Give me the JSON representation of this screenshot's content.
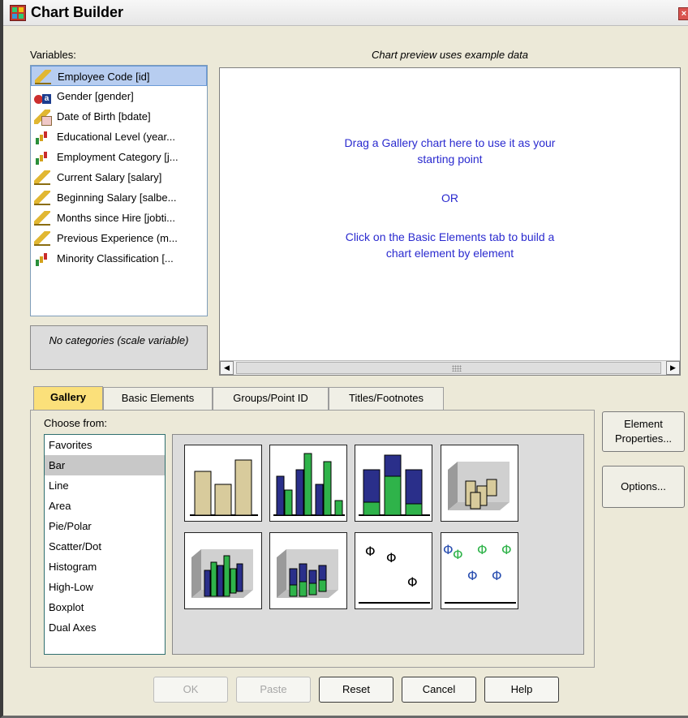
{
  "window": {
    "title": "Chart Builder"
  },
  "variables": {
    "label": "Variables:",
    "items": [
      {
        "label": "Employee Code [id]",
        "icon": "scale-ruler-icon"
      },
      {
        "label": "Gender [gender]",
        "icon": "nominal-icon"
      },
      {
        "label": "Date of Birth [bdate]",
        "icon": "date-icon"
      },
      {
        "label": "Educational Level (year...",
        "icon": "ordinal-bars-icon"
      },
      {
        "label": "Employment Category [j...",
        "icon": "ordinal-bars-icon"
      },
      {
        "label": "Current Salary [salary]",
        "icon": "scale-ruler-icon"
      },
      {
        "label": "Beginning Salary [salbe...",
        "icon": "scale-ruler-icon"
      },
      {
        "label": "Months since Hire [jobti...",
        "icon": "scale-ruler-icon"
      },
      {
        "label": "Previous Experience (m...",
        "icon": "scale-ruler-icon"
      },
      {
        "label": "Minority Classification [...",
        "icon": "ordinal-bars-icon"
      }
    ],
    "no_categories": "No categories (scale variable)"
  },
  "preview": {
    "caption": "Chart preview uses example data",
    "line1": "Drag a Gallery chart here to use it as your",
    "line2": "starting point",
    "or": "OR",
    "line3": "Click on the Basic Elements tab to build a",
    "line4": "chart element by element"
  },
  "tabs": {
    "gallery": "Gallery",
    "basic": "Basic Elements",
    "groups": "Groups/Point ID",
    "titles": "Titles/Footnotes"
  },
  "gallery_panel": {
    "choose_label": "Choose from:",
    "items": [
      "Favorites",
      "Bar",
      "Line",
      "Area",
      "Pie/Polar",
      "Scatter/Dot",
      "Histogram",
      "High-Low",
      "Boxplot",
      "Dual Axes"
    ],
    "selected": "Bar"
  },
  "side_buttons": {
    "element_properties_1": "Element",
    "element_properties_2": "Properties...",
    "options": "Options..."
  },
  "buttons": {
    "ok": "OK",
    "paste": "Paste",
    "reset": "Reset",
    "cancel": "Cancel",
    "help": "Help"
  },
  "colors": {
    "tan": "#d8cb9c",
    "navy": "#2a2f8a",
    "green": "#2fb34a",
    "blue_text": "#2a2acf",
    "tab_active": "#fbe07a"
  }
}
